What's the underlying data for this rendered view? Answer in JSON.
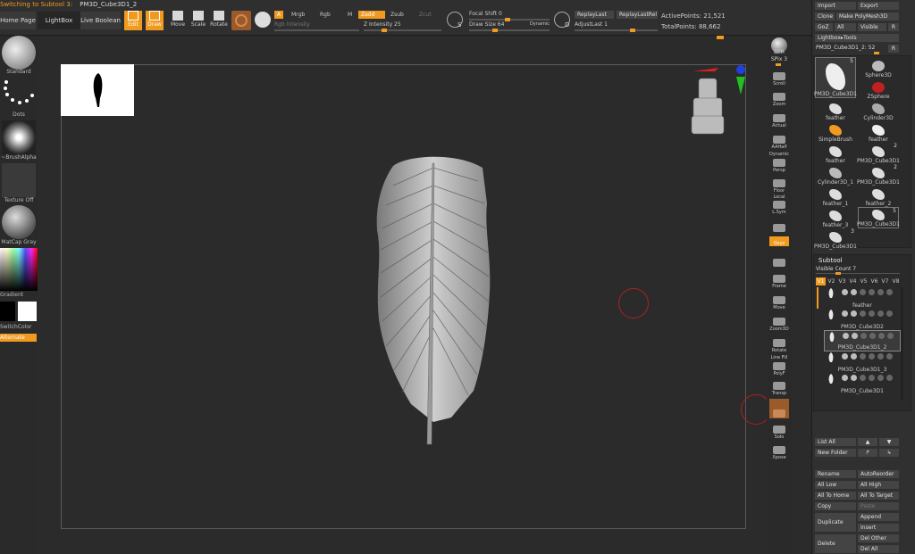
{
  "status": {
    "message": "Switching to Subtool 3:",
    "subtool": "PM3D_Cube3D1_2"
  },
  "topbar": {
    "home_page": "Home Page",
    "lightbox": "LightBox",
    "live_boolean": "Live Boolean",
    "tools": {
      "edit": "Edit",
      "draw": "Draw",
      "move": "Move",
      "scale": "Scale",
      "rotate": "Rotate"
    },
    "mode_a": "A",
    "mrgb": "Mrgb",
    "rgb": "Rgb",
    "m": "M",
    "zadd": "Zadd",
    "zsub": "Zsub",
    "zcut": "Zcut",
    "rgb_intensity": "Rgb Intensity",
    "z_intensity": "Z Intensity 25",
    "z_intensity_value": 0.25,
    "focal_shift": "Focal Shift 0",
    "draw_size": "Draw Size 64",
    "dynamic": "Dynamic",
    "replay_last": "ReplayLast",
    "replay_last_rel": "ReplayLastRel",
    "adjust_last": "AdjustLast 1",
    "active_points": "ActivePoints: 21,521",
    "total_points": "TotalPoints: 88,662",
    "s_label": "S",
    "d_label": "D"
  },
  "leftshelf": {
    "standard": "Standard",
    "dots": "Dots",
    "brush_alpha": "~BrushAlpha",
    "texture_off": "Texture Off",
    "matcap": "MatCap Gray",
    "gradient": "Gradient",
    "switch_color": "SwitchColor",
    "alternate": "Alternate"
  },
  "rightstrip": {
    "bpr": "BPR",
    "spix": "SPix 3",
    "scroll": "Scroll",
    "zoom": "Zoom",
    "actual": "Actual",
    "aahalf": "AAHalf",
    "dynamic": "Dynamic",
    "persp": "Persp",
    "floor": "Floor",
    "local": "Local",
    "lsym": "L.Sym",
    "xyz": "Qxyz",
    "frame": "Frame",
    "move": "Move",
    "zoom3d": "Zoom3D",
    "rotate": "Rotate",
    "line_fill": "Line Fill",
    "polyf": "PolyF",
    "transp": "Transp",
    "solo": "Solo",
    "xpose": "Xpose"
  },
  "rightpanel": {
    "import": "Import",
    "export": "Export",
    "clone": "Clone",
    "make_polymesh": "Make PolyMesh3D",
    "goz": "GoZ",
    "all": "All",
    "visible": "Visible",
    "r": "R",
    "lightbox_tools": "Lightbox▸Tools",
    "current_tool": "PM3D_Cube3D1_2: 52",
    "tools": [
      {
        "name": "PM3D_Cube3D1",
        "count": "5"
      },
      {
        "name": "Sphere3D",
        "count": ""
      },
      {
        "name": "ZSphere",
        "count": ""
      },
      {
        "name": "feather",
        "count": ""
      },
      {
        "name": "Cylinder3D",
        "count": ""
      },
      {
        "name": "SimpleBrush",
        "count": ""
      },
      {
        "name": "feather",
        "count": ""
      },
      {
        "name": "feather",
        "count": ""
      },
      {
        "name": "PM3D_Cube3D1",
        "count": "2"
      },
      {
        "name": "Cylinder3D_1",
        "count": ""
      },
      {
        "name": "PM3D_Cube3D1",
        "count": "2"
      },
      {
        "name": "feather_1",
        "count": ""
      },
      {
        "name": "feather_2",
        "count": ""
      },
      {
        "name": "feather_3",
        "count": ""
      },
      {
        "name": "PM3D_Cube3D1",
        "count": "5"
      },
      {
        "name": "PM3D_Cube3D1",
        "count": "3"
      }
    ],
    "subtool_title": "Subtool",
    "visible_count": "Visible Count 7",
    "versions": [
      "V1",
      "V2",
      "V3",
      "V4",
      "V5",
      "V6",
      "V7",
      "V8"
    ],
    "subtools": [
      "feather",
      "PM3D_Cube3D2",
      "PM3D_Cube3D1_2",
      "PM3D_Cube3D1_3",
      "PM3D_Cube3D1"
    ],
    "list_all": "List All",
    "new_folder": "New Folder",
    "rename": "Rename",
    "auto_reorder": "AutoReorder",
    "all_low": "All Low",
    "all_high": "All High",
    "all_to_home": "All To Home",
    "all_to_target": "All To Target",
    "copy": "Copy",
    "paste": "Paste",
    "duplicate": "Duplicate",
    "append": "Append",
    "insert": "Insert",
    "delete": "Delete",
    "del_other": "Del Other",
    "del_all": "Del All"
  },
  "colors": {
    "accent": "#f19a20",
    "panel": "#303030",
    "canvas": "#2b2b2b"
  }
}
